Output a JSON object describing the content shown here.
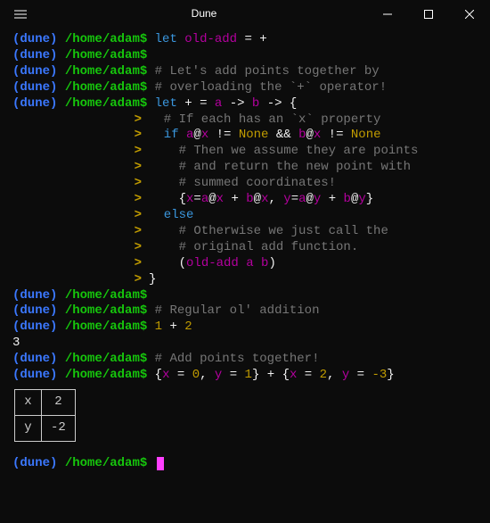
{
  "window": {
    "title": "Dune"
  },
  "prompt": {
    "name": "(dune)",
    "path": "/home/adam",
    "sigil": "$"
  },
  "continuation": ">",
  "lines": {
    "l1_let": "let ",
    "l1_var": "old-add",
    "l1_eq": " = ",
    "l1_plus": "+",
    "l3_cmt": "# Let's add points together by",
    "l4_cmt": "# overloading the `+` operator!",
    "l5_let": "let ",
    "l5_plus": "+",
    "l5_eq": " = ",
    "l5_a": "a",
    "l5_b": "b",
    "l5_arrow": " -> ",
    "l5_brace": "{",
    "c1": "  # If each has an `x` property",
    "c2_if": "  if ",
    "c2_a1": "a",
    "c2_at": "@",
    "c2_x1": "x",
    "c2_neq": " != ",
    "c2_none": "None",
    "c2_and": " && ",
    "c2_b1": "b",
    "c3": "    # Then we assume they are points",
    "c4": "    # and return the new point with",
    "c5": "    # summed coordinates!",
    "c6_open": "    {",
    "c6_x": "x",
    "c6_eq": "=",
    "c6_plus": " + ",
    "c6_comma": ", ",
    "c6_y": "y",
    "c6_close": "}",
    "c7": "  else",
    "c8": "    # Otherwise we just call the",
    "c9": "    # original add function.",
    "c10_open": "    (",
    "c10_fn": "old-add",
    "c10_sp": " ",
    "c10_a": "a",
    "c10_b": "b",
    "c10_close": ")",
    "c11": "}",
    "l_reg_cmt": "# Regular ol' addition",
    "l_add_1": "1",
    "l_add_plus": " + ",
    "l_add_2": "2",
    "l_result_3": "3",
    "l_pts_cmt": "# Add points together!",
    "l_rec_open": "{",
    "l_rec_x": "x",
    "l_rec_eqsp": " = ",
    "l_rec_0": "0",
    "l_rec_comma": ", ",
    "l_rec_y": "y",
    "l_rec_1": "1",
    "l_rec_close": "}",
    "l_rec_plus": " + ",
    "l_rec_2": "2",
    "l_rec_m3": "-3"
  },
  "table": {
    "r1k": "x",
    "r1v": "2",
    "r2k": "y",
    "r2v": "-2"
  }
}
